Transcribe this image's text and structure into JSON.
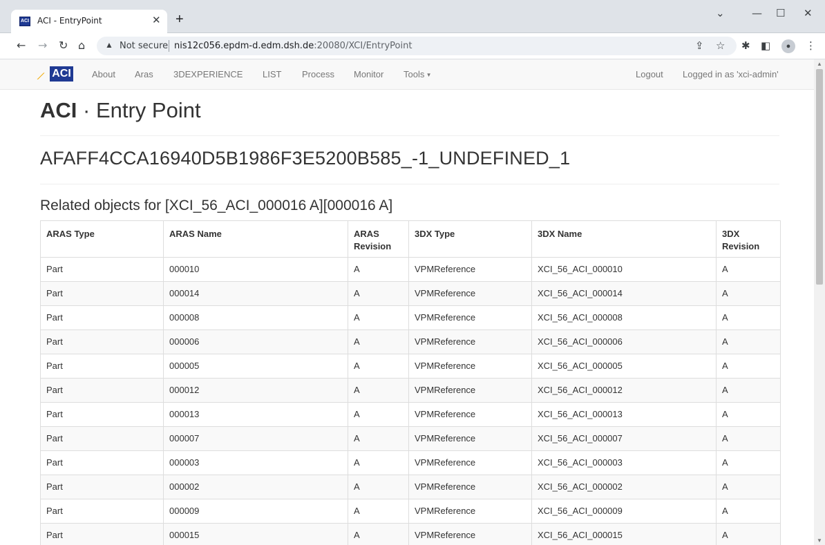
{
  "browser": {
    "tab_favicon": "ACI",
    "tab_title": "ACI - EntryPoint",
    "not_secure": "Not secure",
    "url_host": "nis12c056.epdm-d.edm.dsh.de",
    "url_path": ":20080/XCI/EntryPoint",
    "icons": [
      "back-arrow",
      "forward-arrow",
      "reload",
      "home",
      "warning",
      "share",
      "star",
      "extensions",
      "side-panel",
      "profile",
      "menu"
    ]
  },
  "navbar": {
    "brand": "ACI",
    "links": [
      "About",
      "Aras",
      "3DEXPERIENCE",
      "LIST",
      "Process",
      "Monitor",
      "Tools"
    ],
    "logout": "Logout",
    "logged_in": "Logged in as 'xci-admin'"
  },
  "page": {
    "title_bold": "ACI",
    "title_rest": " · Entry Point",
    "entry_id": "AFAFF4CCA16940D5B1986F3E5200B585_-1_UNDEFINED_1",
    "section_title": "Related objects for [XCI_56_ACI_000016 A][000016 A]"
  },
  "table": {
    "headers": [
      "ARAS Type",
      "ARAS Name",
      "ARAS Revision",
      "3DX Type",
      "3DX Name",
      "3DX Revision"
    ],
    "rows": [
      [
        "Part",
        "000010",
        "A",
        "VPMReference",
        "XCI_56_ACI_000010",
        "A"
      ],
      [
        "Part",
        "000014",
        "A",
        "VPMReference",
        "XCI_56_ACI_000014",
        "A"
      ],
      [
        "Part",
        "000008",
        "A",
        "VPMReference",
        "XCI_56_ACI_000008",
        "A"
      ],
      [
        "Part",
        "000006",
        "A",
        "VPMReference",
        "XCI_56_ACI_000006",
        "A"
      ],
      [
        "Part",
        "000005",
        "A",
        "VPMReference",
        "XCI_56_ACI_000005",
        "A"
      ],
      [
        "Part",
        "000012",
        "A",
        "VPMReference",
        "XCI_56_ACI_000012",
        "A"
      ],
      [
        "Part",
        "000013",
        "A",
        "VPMReference",
        "XCI_56_ACI_000013",
        "A"
      ],
      [
        "Part",
        "000007",
        "A",
        "VPMReference",
        "XCI_56_ACI_000007",
        "A"
      ],
      [
        "Part",
        "000003",
        "A",
        "VPMReference",
        "XCI_56_ACI_000003",
        "A"
      ],
      [
        "Part",
        "000002",
        "A",
        "VPMReference",
        "XCI_56_ACI_000002",
        "A"
      ],
      [
        "Part",
        "000009",
        "A",
        "VPMReference",
        "XCI_56_ACI_000009",
        "A"
      ],
      [
        "Part",
        "000015",
        "A",
        "VPMReference",
        "XCI_56_ACI_000015",
        "A"
      ]
    ]
  },
  "colors": {
    "brand_blue": "#1f3a93",
    "brand_swoosh": "#f2a900",
    "navbar_bg": "#f8f8f8",
    "link_gray": "#777777"
  }
}
